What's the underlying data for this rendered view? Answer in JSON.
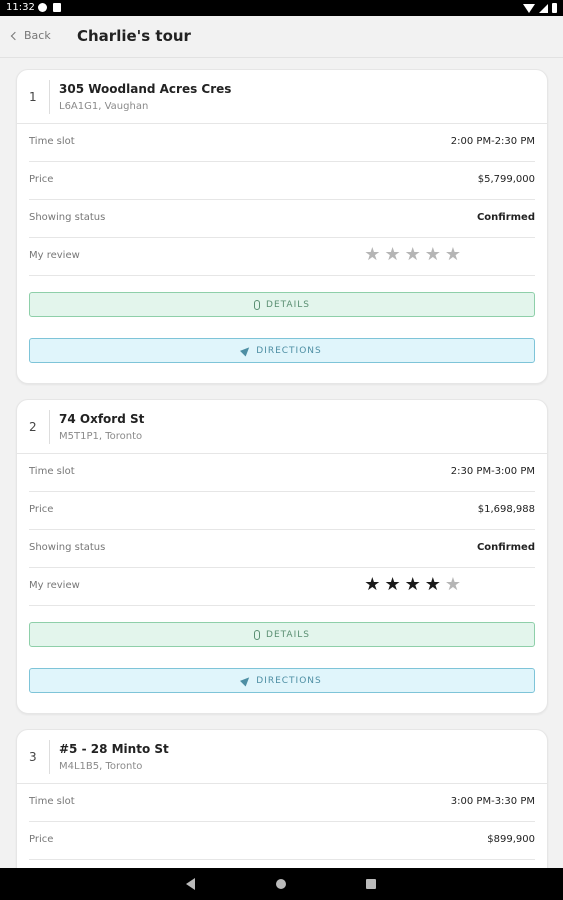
{
  "status_bar": {
    "time": "11:32"
  },
  "header": {
    "back_label": "Back",
    "title": "Charlie's tour"
  },
  "labels": {
    "time_slot": "Time slot",
    "price": "Price",
    "showing_status": "Showing status",
    "my_review": "My review",
    "details": "DETAILS",
    "directions": "DIRECTIONS"
  },
  "tours": [
    {
      "number": "1",
      "address": "305 Woodland Acres Cres",
      "sub": "L6A1G1, Vaughan",
      "time_slot": "2:00 PM-2:30 PM",
      "price": "$5,799,000",
      "status": "Confirmed",
      "rating": 0,
      "rating_max": 5
    },
    {
      "number": "2",
      "address": "74 Oxford St",
      "sub": "M5T1P1, Toronto",
      "time_slot": "2:30 PM-3:00 PM",
      "price": "$1,698,988",
      "status": "Confirmed",
      "rating": 4,
      "rating_max": 5
    },
    {
      "number": "3",
      "address": "#5 - 28 Minto St",
      "sub": "M4L1B5, Toronto",
      "time_slot": "3:00 PM-3:30 PM",
      "price": "$899,900"
    }
  ]
}
